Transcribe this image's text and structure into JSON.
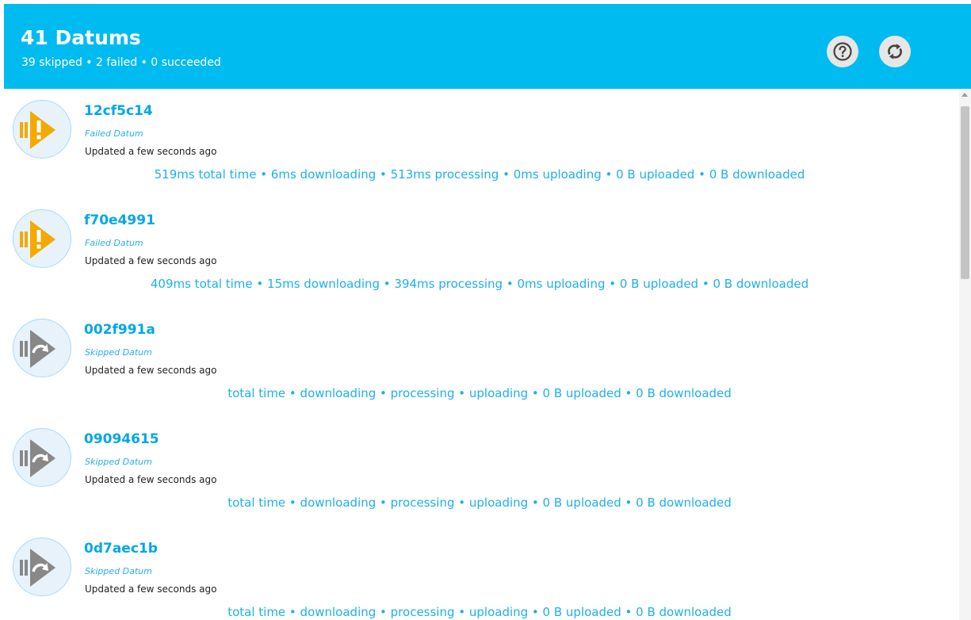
{
  "header": {
    "title": "41 Datums",
    "subtitle": "39 skipped • 2 failed • 0 succeeded",
    "help_icon": "question-circle-icon",
    "refresh_icon": "refresh-icon"
  },
  "colors": {
    "header_bg": "#00bbef",
    "link": "#00a7e8",
    "failed_icon": "#f2aa00",
    "skipped_icon": "#888888"
  },
  "datums": [
    {
      "id": "12cf5c14",
      "status": "Failed Datum",
      "updated": "Updated a few seconds ago",
      "stats": "519ms total time • 6ms downloading • 513ms processing • 0ms uploading • 0 B uploaded • 0 B downloaded",
      "icon": "failed-datum-icon"
    },
    {
      "id": "f70e4991",
      "status": "Failed Datum",
      "updated": "Updated a few seconds ago",
      "stats": "409ms total time • 15ms downloading • 394ms processing • 0ms uploading • 0 B uploaded • 0 B downloaded",
      "icon": "failed-datum-icon"
    },
    {
      "id": "002f991a",
      "status": "Skipped Datum",
      "updated": "Updated a few seconds ago",
      "stats": "total time • downloading • processing • uploading • 0 B uploaded • 0 B downloaded",
      "icon": "skipped-datum-icon"
    },
    {
      "id": "09094615",
      "status": "Skipped Datum",
      "updated": "Updated a few seconds ago",
      "stats": "total time • downloading • processing • uploading • 0 B uploaded • 0 B downloaded",
      "icon": "skipped-datum-icon"
    },
    {
      "id": "0d7aec1b",
      "status": "Skipped Datum",
      "updated": "Updated a few seconds ago",
      "stats": "total time • downloading • processing • uploading • 0 B uploaded • 0 B downloaded",
      "icon": "skipped-datum-icon"
    }
  ]
}
